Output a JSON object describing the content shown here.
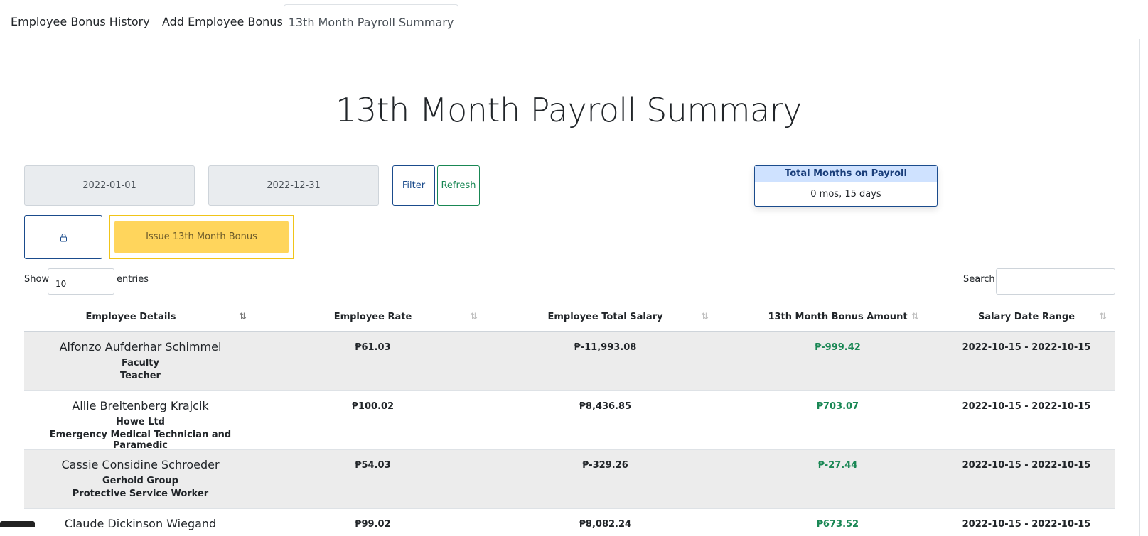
{
  "tabs": [
    "Employee Bonus History",
    "Add Employee Bonus",
    "13th Month Payroll Summary"
  ],
  "page_title": "13th Month Payroll Summary",
  "filters": {
    "start_date": "2022-01-01",
    "end_date": "2022-12-31",
    "filter_label": "Filter",
    "refresh_label": "Refresh"
  },
  "lock_icon": "lock-icon",
  "issue_label": "Issue 13th Month Bonus",
  "months_card": {
    "title": "Total Months on Payroll",
    "value": "0 mos, 15 days"
  },
  "table_controls": {
    "show_label": "Show",
    "entries_count": "10",
    "entries_label": "entries",
    "search_label": "Search:"
  },
  "columns": [
    "Employee Details",
    "Employee Rate",
    "Employee Total Salary",
    "13th Month Bonus Amount",
    "Salary Date Range"
  ],
  "rows": [
    {
      "name": "Alfonzo Aufderhar Schimmel",
      "company": "Faculty",
      "position": "Teacher",
      "rate": "₱61.03",
      "total": "₱-11,993.08",
      "bonus": "₱-999.42",
      "range": "2022-10-15 - 2022-10-15"
    },
    {
      "name": "Allie Breitenberg Krajcik",
      "company": "Howe Ltd",
      "position": "Emergency Medical Technician and Paramedic",
      "rate": "₱100.02",
      "total": "₱8,436.85",
      "bonus": "₱703.07",
      "range": "2022-10-15 - 2022-10-15"
    },
    {
      "name": "Cassie Considine Schroeder",
      "company": "Gerhold Group",
      "position": "Protective Service Worker",
      "rate": "₱54.03",
      "total": "₱-329.26",
      "bonus": "₱-27.44",
      "range": "2022-10-15 - 2022-10-15"
    },
    {
      "name": "Claude Dickinson Wiegand",
      "company": "",
      "position": "",
      "rate": "₱99.02",
      "total": "₱8,082.24",
      "bonus": "₱673.52",
      "range": "2022-10-15 - 2022-10-15"
    }
  ],
  "colors": {
    "primary": "#1a4b8c",
    "success": "#198754",
    "warning": "#ffd55c",
    "stripe": "#ececec"
  }
}
